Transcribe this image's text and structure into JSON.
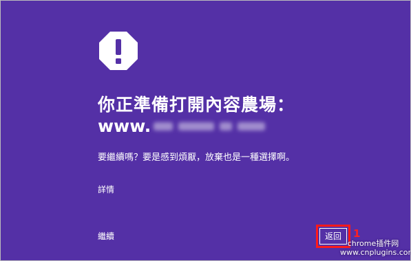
{
  "page": {
    "background": "#5430a6",
    "title": "你正準備打開內容農場：",
    "site_prefix": "www.",
    "message": "要繼續嗎？要是感到煩厭，放棄也是一種選擇啊。",
    "details_label": "詳情",
    "continue_label": "繼續",
    "back_button_label": "返回",
    "icon": "warning-octagon-icon"
  },
  "annotation": {
    "highlight_color": "#ff1a1a",
    "step_number": "1"
  },
  "watermark": {
    "line1": "chrome插件网",
    "line2": "www.cnplugins.com"
  }
}
